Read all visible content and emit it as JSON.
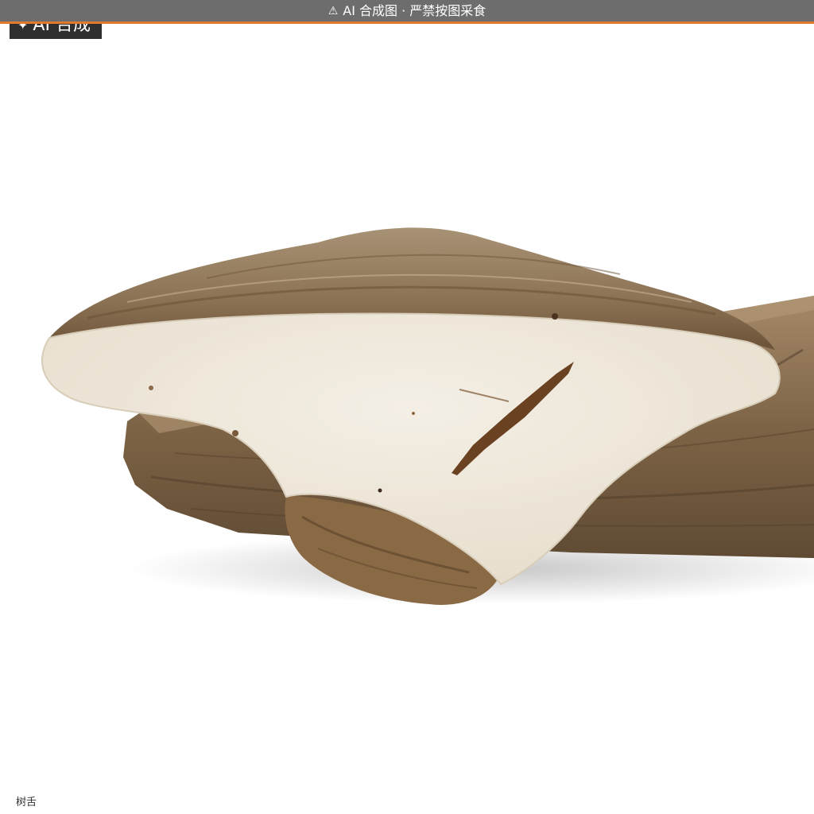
{
  "banner": {
    "icon": "warning-icon",
    "text": "AI 合成图 · 严禁按图采食"
  },
  "badge": {
    "icon": "sparkle-icon",
    "text": "AI 合成"
  },
  "caption": {
    "text": "树舌"
  },
  "colors": {
    "banner_bg": "#6d6d6d",
    "banner_accent": "#e07b2e",
    "badge_bg": "#2f2f2f",
    "pore_surface": "#efe9dd",
    "cap_brown": "#8f7558",
    "wood": "#8a7052"
  }
}
